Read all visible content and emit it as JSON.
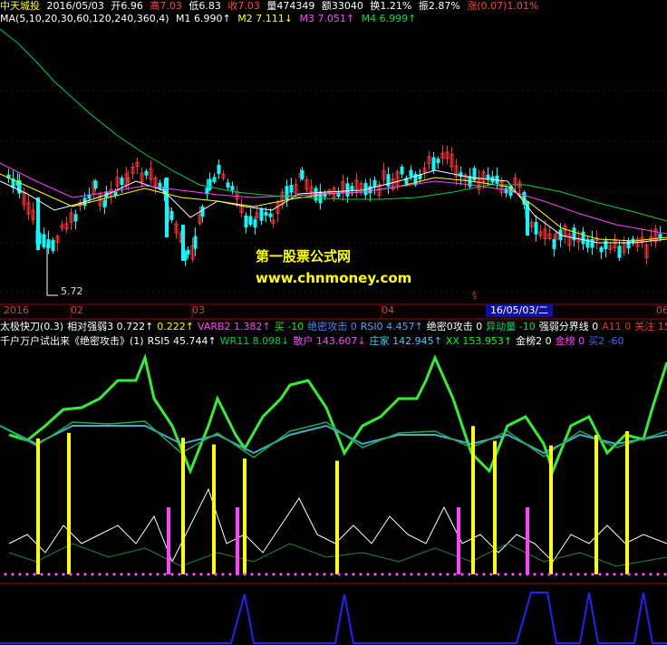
{
  "header": {
    "name": "中天城投",
    "date": "2016/05/03",
    "open": "开6.96",
    "high": "高7.03",
    "low": "低6.83",
    "close": "收7.03",
    "volume": "量474349",
    "amount": "额33040",
    "turnover": "换1.21%",
    "amplitude": "振2.87%",
    "change": "涨(0.07)1.01%"
  },
  "ma_row": {
    "label": "MA(5,10,20,30,60,120,240,360,4)",
    "m1": "M1 6.990↑",
    "m2": "M2 7.111↓",
    "m3": "M3 7.051↑",
    "m4": "M4 6.999↑"
  },
  "price_axis": {
    "labels": [
      "2016",
      "02",
      "03",
      "04",
      "06"
    ],
    "selected_date": "16/05/03/二",
    "low_mark": "5.72",
    "section_mark": "§"
  },
  "watermark": {
    "line1": "第一股票公式网",
    "line2": "www.chnmoney.com"
  },
  "indicator_row1": {
    "items": [
      {
        "text": "太极快刀(0.3)",
        "color": "#ffffff"
      },
      {
        "text": "相对强弱3 0.722↑",
        "color": "#ffffff"
      },
      {
        "text": "0.222↑",
        "color": "#ffff00"
      },
      {
        "text": "VARB2 1.382↑",
        "color": "#ff44ff"
      },
      {
        "text": "买 -10",
        "color": "#00ff00"
      },
      {
        "text": "绝密攻击 0",
        "color": "#4488ff"
      },
      {
        "text": "RSI0 4.457↑",
        "color": "#44aaff"
      },
      {
        "text": "绝密0攻击 0",
        "color": "#ffffff"
      },
      {
        "text": "异动量 -10",
        "color": "#00dd66"
      },
      {
        "text": "强弱分界线 0",
        "color": "#ffffff"
      },
      {
        "text": "A11 0",
        "color": "#dd3333"
      },
      {
        "text": "关注 15",
        "color": "#ff3333"
      }
    ]
  },
  "indicator_row2": {
    "items": [
      {
        "text": "千户万户试出来《绝密攻击》(1)",
        "color": "#ffffff"
      },
      {
        "text": "RSI5 45.744↑",
        "color": "#ffffff"
      },
      {
        "text": "WR11 8.098↓",
        "color": "#00cc44"
      },
      {
        "text": "散户 143.607↓",
        "color": "#ff44ff"
      },
      {
        "text": "庄家 142.945↑",
        "color": "#44ccff"
      },
      {
        "text": "XX 153.953↑",
        "color": "#00ff00"
      },
      {
        "text": "金榜2 0",
        "color": "#ffffff"
      },
      {
        "text": "金榜 0",
        "color": "#ff44ff"
      },
      {
        "text": "买2 -60",
        "color": "#4466ff"
      }
    ]
  },
  "colors": {
    "up": "#ff3333",
    "down": "#00ffff",
    "ma_white": "#ffffff",
    "ma_yellow": "#ffff00",
    "ma_magenta": "#ff44ff",
    "ma_green": "#00cc44",
    "divider": "#aa0000"
  }
}
